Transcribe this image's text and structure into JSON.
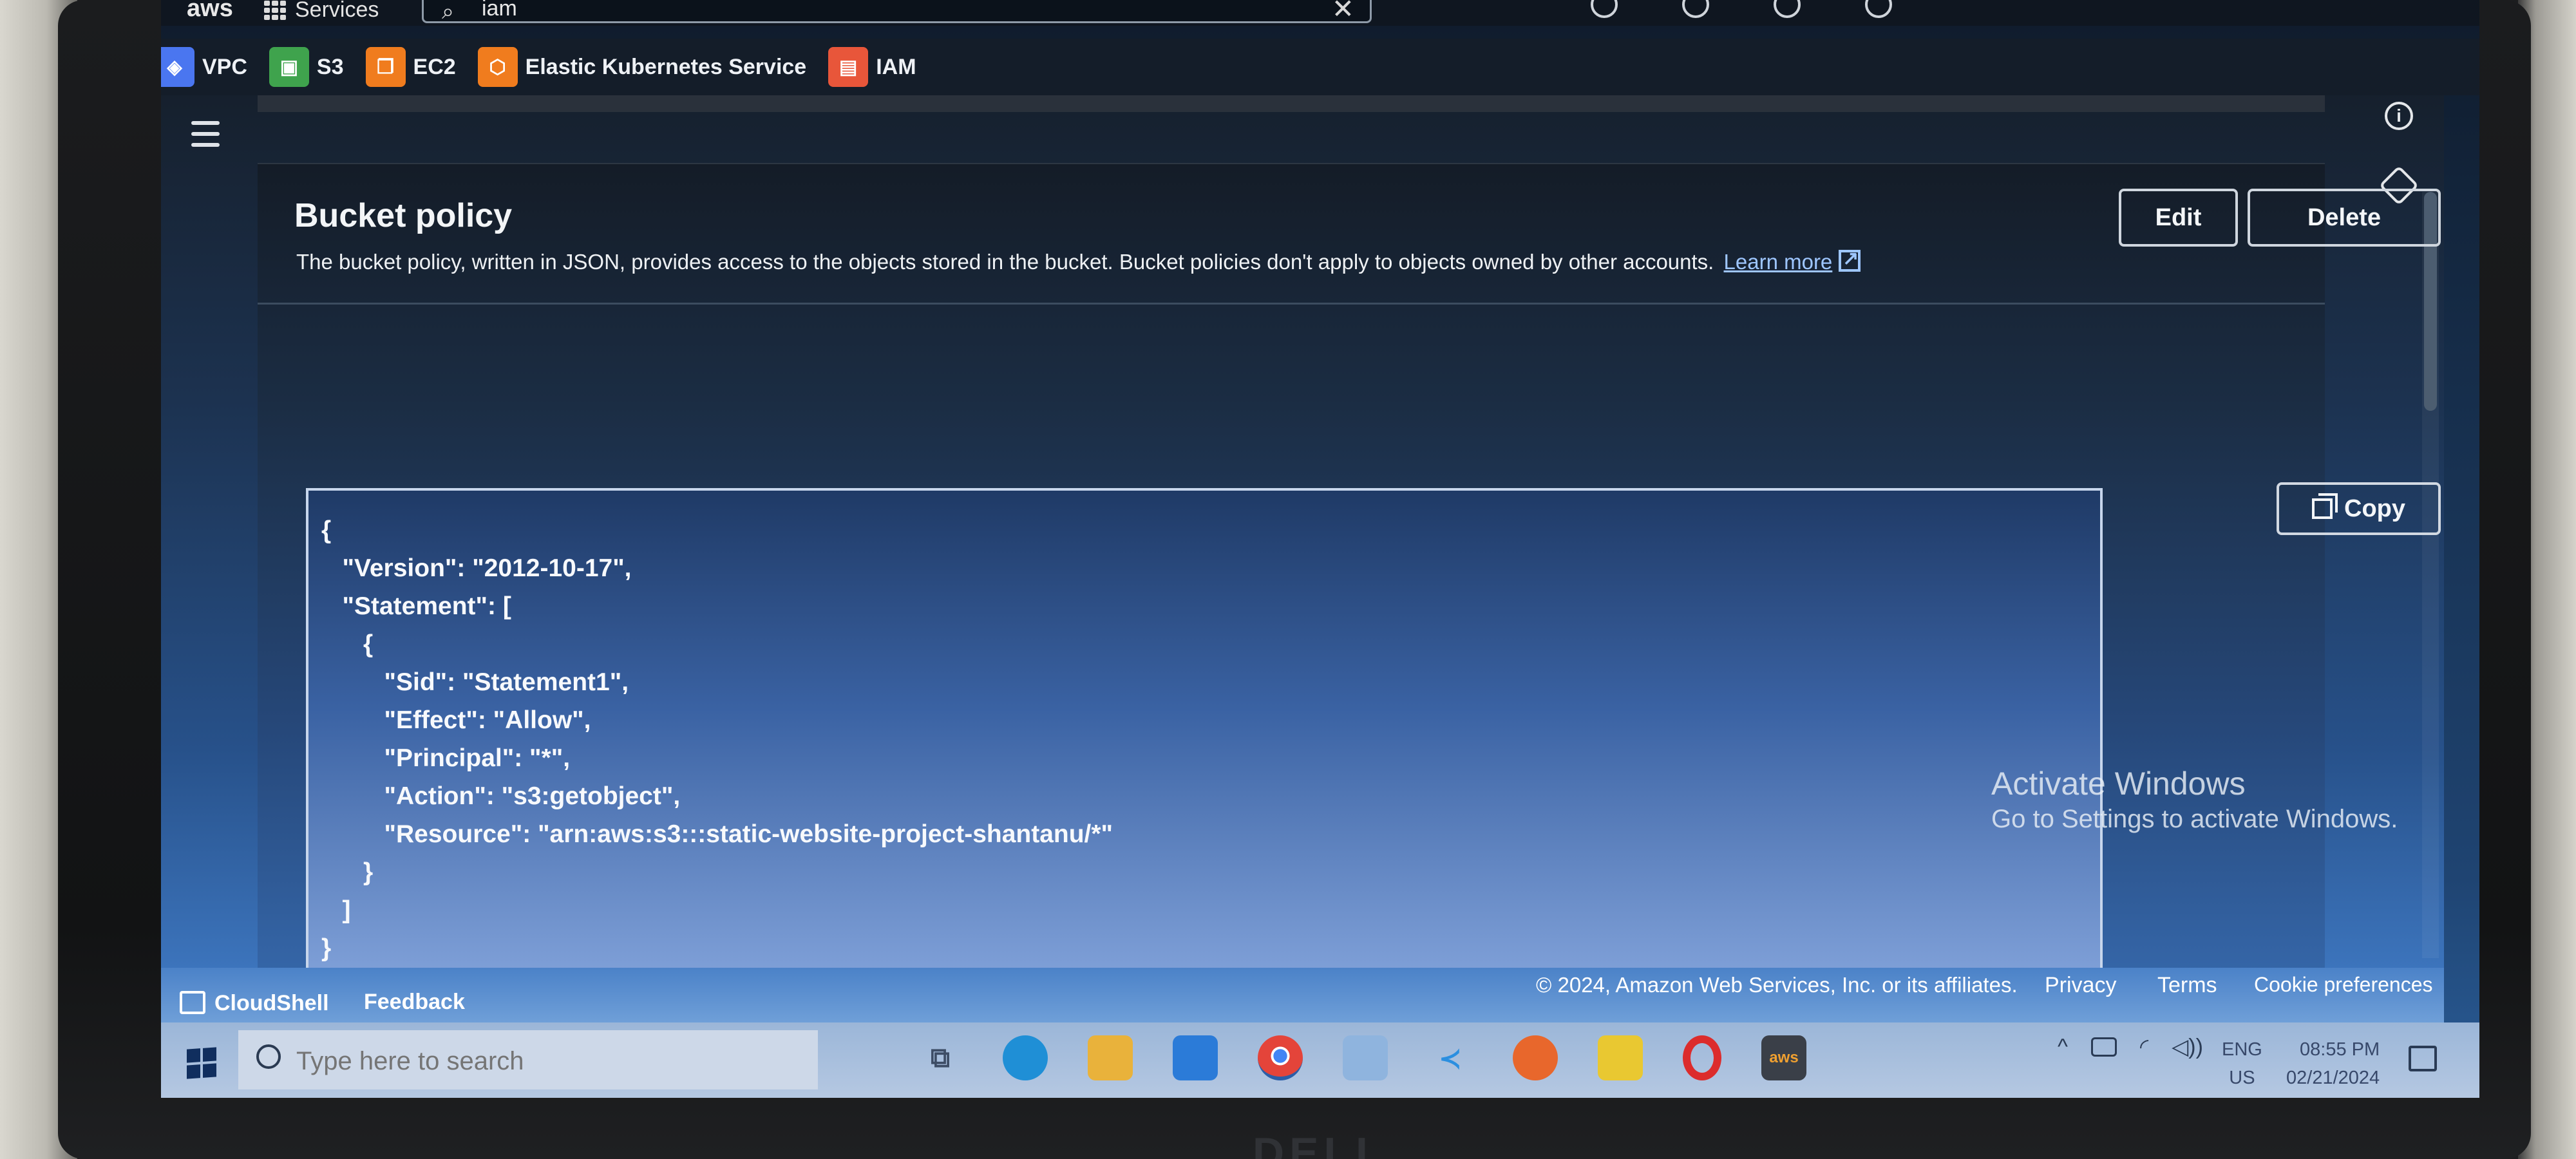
{
  "topnav": {
    "logo": "aws",
    "services_label": "Services",
    "search_value": "iam"
  },
  "favorites": [
    {
      "label": "VPC",
      "color": "#4a76f0",
      "icon": "vpc-icon"
    },
    {
      "label": "S3",
      "color": "#3fa34d",
      "icon": "s3-icon"
    },
    {
      "label": "EC2",
      "color": "#f07c1e",
      "icon": "ec2-icon"
    },
    {
      "label": "Elastic Kubernetes Service",
      "color": "#f07c1e",
      "icon": "eks-icon"
    },
    {
      "label": "IAM",
      "color": "#e8563a",
      "icon": "iam-icon"
    }
  ],
  "bucket_policy": {
    "title": "Bucket policy",
    "description": "The bucket policy, written in JSON, provides access to the objects stored in the bucket. Bucket policies don't apply to objects owned by other accounts.",
    "learn_more": "Learn more",
    "edit_label": "Edit",
    "delete_label": "Delete",
    "copy_label": "Copy",
    "policy_json": "{\n   \"Version\": \"2012-10-17\",\n   \"Statement\": [\n      {\n         \"Sid\": \"Statement1\",\n         \"Effect\": \"Allow\",\n         \"Principal\": \"*\",\n         \"Action\": \"s3:getobject\",\n         \"Resource\": \"arn:aws:s3:::static-website-project-shantanu/*\"\n      }\n   ]\n}"
  },
  "watermark": {
    "line1": "Activate Windows",
    "line2": "Go to Settings to activate Windows."
  },
  "footer": {
    "cloudshell": "CloudShell",
    "feedback": "Feedback",
    "copyright": "© 2024, Amazon Web Services, Inc. or its affiliates.",
    "privacy": "Privacy",
    "terms": "Terms",
    "cookie": "Cookie preferences"
  },
  "taskbar": {
    "search_placeholder": "Type here to search",
    "apps": [
      {
        "name": "task-view-icon",
        "color": "#3d4d66"
      },
      {
        "name": "edge-icon",
        "color": "#1f8fd6"
      },
      {
        "name": "file-explorer-icon",
        "color": "#e9b23b"
      },
      {
        "name": "mail-icon",
        "color": "#2b7bd8"
      },
      {
        "name": "chrome-icon",
        "color": "#e4443a"
      },
      {
        "name": "folder-icon",
        "color": "#8fb4de"
      },
      {
        "name": "vscode-icon",
        "color": "#2b8fe0"
      },
      {
        "name": "firefox-icon",
        "color": "#e8672c"
      },
      {
        "name": "sticky-notes-icon",
        "color": "#e9c831"
      },
      {
        "name": "opera-icon",
        "color": "#dc2c2c"
      },
      {
        "name": "aws-app-icon",
        "color": "#3a3f48"
      }
    ],
    "lang_top": "ENG",
    "lang_bottom": "US",
    "time": "08:55 PM",
    "date": "02/21/2024"
  },
  "brand": "DELL"
}
